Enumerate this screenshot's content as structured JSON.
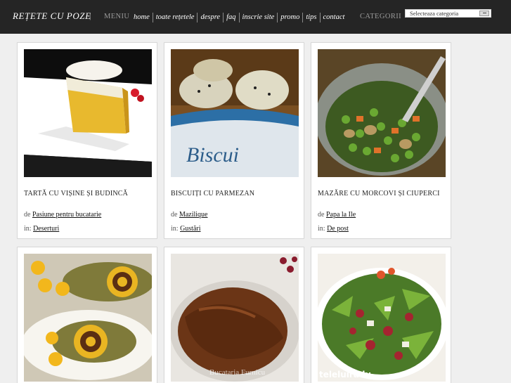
{
  "header": {
    "logo": "REȚETE CU POZE",
    "logo_sep": "|",
    "menu_label": "MENIU",
    "nav": [
      "home",
      "toate rețetele",
      "despre",
      "faq",
      "inscrie site",
      "promo",
      "tips",
      "contact"
    ],
    "categories_label": "CATEGORII",
    "category_select": "Selecteaza categoria"
  },
  "labels": {
    "by": "de",
    "in": "in:"
  },
  "cards": [
    {
      "title": "TARTĂ CU VIȘINE ȘI BUDINCĂ",
      "author": "Pasiune pentru bucatarie",
      "category": "Deserturi"
    },
    {
      "title": "BISCUIȚI CU PARMEZAN",
      "author": "Mazilique",
      "category": "Gustări"
    },
    {
      "title": "MAZĂRE CU MORCOVI ȘI CIUPERCI",
      "author": "Papa la Ile",
      "category": "De post"
    },
    {
      "title": "",
      "author": "",
      "category": ""
    },
    {
      "title": "",
      "author": "",
      "category": ""
    },
    {
      "title": "",
      "author": "",
      "category": ""
    }
  ],
  "watermarks": {
    "card5": "Bucataria Furnicu",
    "card6": "teleluiradu",
    "card2_tin": "Biscui"
  }
}
